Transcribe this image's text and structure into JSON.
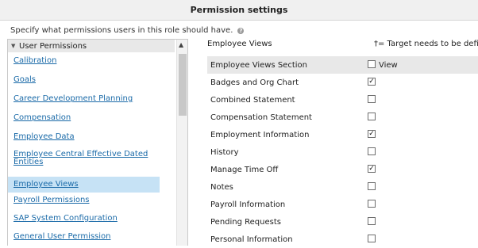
{
  "title": "Permission settings",
  "description": "Specify what permissions users in this role should have.",
  "help_icon": "question-circle-icon",
  "left_panel": {
    "header": "User Permissions",
    "items": [
      {
        "label": "Calibration",
        "selected": false
      },
      {
        "label": "Goals",
        "selected": false
      },
      {
        "label": "Career Development Planning",
        "selected": false
      },
      {
        "label": "Compensation",
        "selected": false
      },
      {
        "label": "Employee Data",
        "selected": false
      },
      {
        "label": "Employee Central Effective Dated Entities",
        "selected": false
      },
      {
        "label": "Employee Views",
        "selected": true
      },
      {
        "label": "Payroll Permissions",
        "selected": false
      },
      {
        "label": "SAP System Configuration",
        "selected": false
      },
      {
        "label": "General User Permission",
        "selected": false
      }
    ]
  },
  "right_panel": {
    "header": "Employee Views",
    "note": "†= Target needs to be define",
    "section": {
      "label": "Employee Views Section",
      "checkbox_label": "View",
      "checked": false
    },
    "rows": [
      {
        "label": "Badges and Org Chart",
        "checked": true
      },
      {
        "label": "Combined Statement",
        "checked": false
      },
      {
        "label": "Compensation Statement",
        "checked": false
      },
      {
        "label": "Employment Information",
        "checked": true
      },
      {
        "label": "History",
        "checked": false
      },
      {
        "label": "Manage Time Off",
        "checked": true
      },
      {
        "label": "Notes",
        "checked": false
      },
      {
        "label": "Payroll Information",
        "checked": false
      },
      {
        "label": "Pending Requests",
        "checked": false
      },
      {
        "label": "Personal Information",
        "checked": false
      }
    ]
  }
}
